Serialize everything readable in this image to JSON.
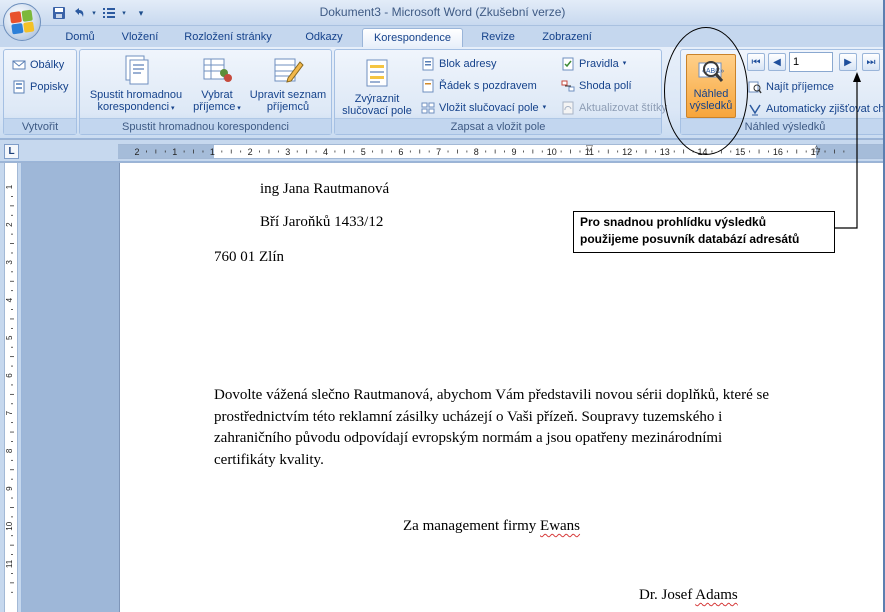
{
  "window": {
    "title": "Dokument3 - Microsoft Word (Zkušební verze)"
  },
  "quick_access": {
    "save_icon": "save-icon",
    "undo_icon": "undo-icon",
    "list_icon": "numbering-icon"
  },
  "tabs": [
    {
      "label": "Domů"
    },
    {
      "label": "Vložení"
    },
    {
      "label": "Rozložení stránky"
    },
    {
      "label": "Odkazy"
    },
    {
      "label": "Korespondence",
      "active": true
    },
    {
      "label": "Revize"
    },
    {
      "label": "Zobrazení"
    }
  ],
  "ribbon": {
    "create": {
      "label": "Vytvořit",
      "envelopes": "Obálky",
      "labels": "Popisky"
    },
    "start_merge": {
      "label": "Spustit hromadnou korespondenci",
      "start_line1": "Spustit hromadnou",
      "start_line2": "korespondenci",
      "select_line1": "Vybrat",
      "select_line2": "příjemce",
      "edit_line1": "Upravit seznam",
      "edit_line2": "příjemců"
    },
    "write_insert": {
      "label": "Zapsat a vložit pole",
      "highlight_line1": "Zvýraznit",
      "highlight_line2": "slučovací pole",
      "address_block": "Blok adresy",
      "greeting_line": "Řádek s pozdravem",
      "insert_field": "Vložit slučovací pole",
      "rules": "Pravidla",
      "match_fields": "Shoda polí",
      "update_labels": "Aktualizovat štítky"
    },
    "preview": {
      "label": "Náhled výsledků",
      "preview_line1": "Náhled",
      "preview_line2": "výsledků",
      "record_number": "1",
      "find_recipient": "Najít příjemce",
      "auto_check": "Automaticky zjišťovat chyby"
    }
  },
  "ruler": {
    "tab_selector": "L",
    "h_numbers": [
      "2",
      "1",
      "1",
      "2",
      "3",
      "4",
      "5",
      "6",
      "7",
      "8",
      "9",
      "10",
      "11",
      "12",
      "13",
      "14",
      "15",
      "16",
      "17"
    ],
    "v_numbers": [
      "1",
      "2",
      "3",
      "4",
      "5",
      "6",
      "7",
      "8",
      "9",
      "10",
      "11"
    ]
  },
  "document": {
    "recipient_name": "ing Jana Rautmanová",
    "street": "Bří Jaroňků 1433/12",
    "city": "760 01 Zlín",
    "body_line1": "Dovolte vážená slečno Rautmanová, abychom Vám představili novou sérii doplňků, které se",
    "body_line2": "prostřednictvím této reklamní zásilky ucházejí o Vaši přízeň. Soupravy tuzemského i",
    "body_line3": "zahraničního původu odpovídají evropským normám a jsou opatřeny mezinárodními",
    "body_line4": "certifikáty kvality.",
    "closing_prefix": "Za management firmy ",
    "closing_company": "Ewans",
    "signature_prefix": "Dr. Josef ",
    "signature_name": "Adams"
  },
  "callout": {
    "line1": "Pro snadnou prohlídku výsledků",
    "line2": "použijeme posuvník databází adresátů"
  },
  "colors": {
    "ribbon_bg": "#dbe7f6",
    "preview_button": "#f7a53b",
    "doc_background": "#9eb7d8"
  }
}
